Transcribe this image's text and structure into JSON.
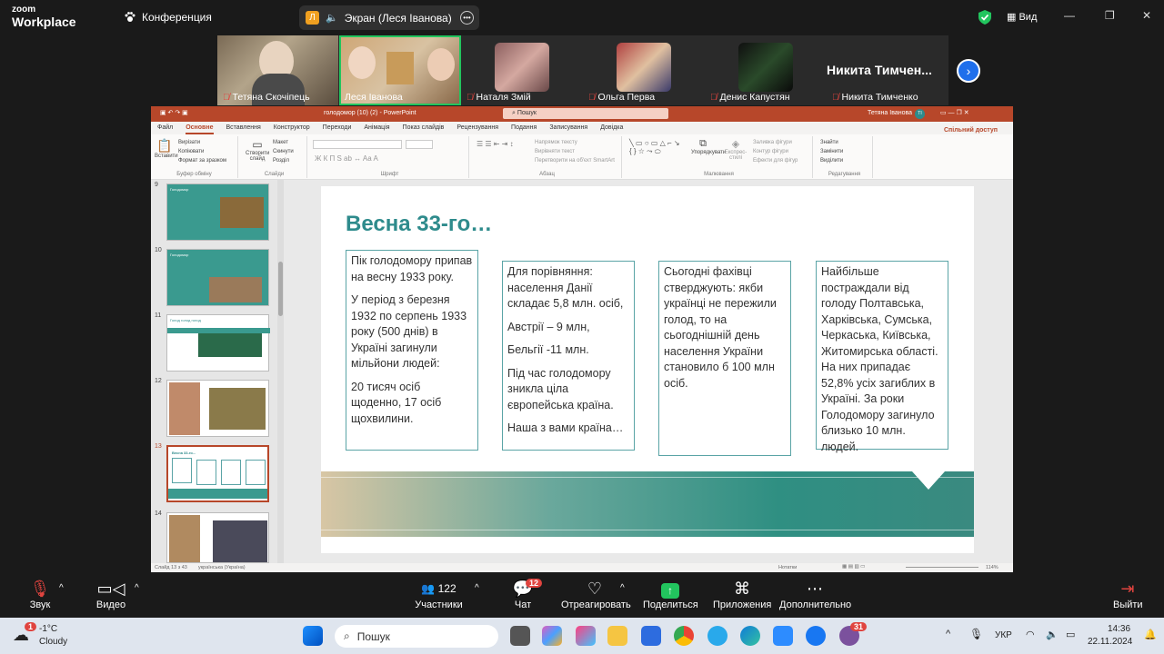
{
  "zoom": {
    "logo_line1": "zoom",
    "logo_line2": "Workplace",
    "conference_label": "Конференция",
    "screen_share_label": "Экран (Леся Іванова)",
    "screen_share_avatar": "Л",
    "view_label": "Вид",
    "more_name": "Никита Тимчен...",
    "participants": [
      {
        "name": "Тетяна Скочіпець",
        "muted": true
      },
      {
        "name": "Леся Іванова",
        "muted": false
      },
      {
        "name": "Наталя Змій",
        "muted": true
      },
      {
        "name": "Ольга Перва",
        "muted": true
      },
      {
        "name": "Денис Капустян",
        "muted": true
      },
      {
        "name": "Никита Тимченко",
        "muted": true
      }
    ],
    "toolbar": {
      "sound": "Звук",
      "video": "Видео",
      "participants": "Участники",
      "participants_count": "122",
      "chat": "Чат",
      "chat_badge": "12",
      "react": "Отреагировать",
      "share": "Поделиться",
      "apps": "Приложения",
      "more": "Дополнительно",
      "leave": "Выйти"
    }
  },
  "ppt": {
    "title": "голодомор (10) (2)  -  PowerPoint",
    "search": "Пошук",
    "user": "Тетяна Іванова",
    "user_initials": "ТІ",
    "tabs": [
      "Файл",
      "Основне",
      "Вставлення",
      "Конструктор",
      "Переходи",
      "Анімація",
      "Показ слайдів",
      "Рецензування",
      "Подання",
      "Записування",
      "Довідка"
    ],
    "active_tab": "Основне",
    "share": "Спільний доступ",
    "ribbon": {
      "paste": "Вставити",
      "cut": "Вирізати",
      "copy": "Копіювати",
      "format": "Формат за зразком",
      "clipboard": "Буфер обміну",
      "new_slide": "Створити слайд",
      "layout": "Макет",
      "reset": "Скинути",
      "section": "Розділ",
      "slides": "Слайди",
      "font": "Шрифт",
      "direction": "Напрямок тексту",
      "align": "Вирівняти текст",
      "smartart": "Перетворити на об'єкт SmartArt",
      "paragraph": "Абзац",
      "arrange": "Упорядкувати",
      "styles": "Експрес-стилі",
      "fill": "Заливка фігури",
      "outline": "Контур фігури",
      "effects": "Ефекти для фігур",
      "drawing": "Малювання",
      "find": "Знайти",
      "replace": "Замінити",
      "select": "Виділити",
      "editing": "Редагування"
    },
    "thumbnails": [
      {
        "num": "9",
        "title": "Голодомор"
      },
      {
        "num": "10",
        "title": "Голодомор"
      },
      {
        "num": "11",
        "title": "Голод голод голод"
      },
      {
        "num": "12",
        "title": ""
      },
      {
        "num": "13",
        "title": "Весна 33-го..."
      },
      {
        "num": "14",
        "title": ""
      }
    ],
    "slide": {
      "title": "Весна 33-го…",
      "box1": [
        "Пік голодомору припав на весну 1933 року.",
        "У період з березня 1932 по серпень 1933 року (500 днів) в Україні загинули мільйони людей:",
        "20 тисяч осіб щоденно, 17 осіб щохвилини."
      ],
      "box2": [
        "Для порівняння: населення Данії складає 5,8 млн. осіб,",
        "Австрії – 9 млн,",
        "Бельгії -11 млн.",
        "Під час голодомору зникла ціла європейська країна.",
        "Наша з вами країна…"
      ],
      "box3": [
        "Сьогодні фахівці стверджують: якби українці не пережили голод, то на сьогоднішній день населення України становило б 100 млн осіб."
      ],
      "box4": [
        "Найбільше постраждали від голоду Полтавська, Харківська, Сумська, Черкаська, Київська, Житомирська області. На них припадає 52,8% усіх загиблих в Україні. За роки Голодомору загинуло близько 10 млн. людей."
      ]
    },
    "status_left": "Слайд 13 з 43",
    "status_lang": "українська (Україна)",
    "status_notes": "Нотатки",
    "status_zoom": "114%"
  },
  "taskbar": {
    "weather_temp": "-1°C",
    "weather_desc": "Cloudy",
    "weather_badge": "1",
    "search": "Пошук",
    "lang": "УКР",
    "time": "14:36",
    "date": "22.11.2024",
    "viber_badge": "31"
  }
}
